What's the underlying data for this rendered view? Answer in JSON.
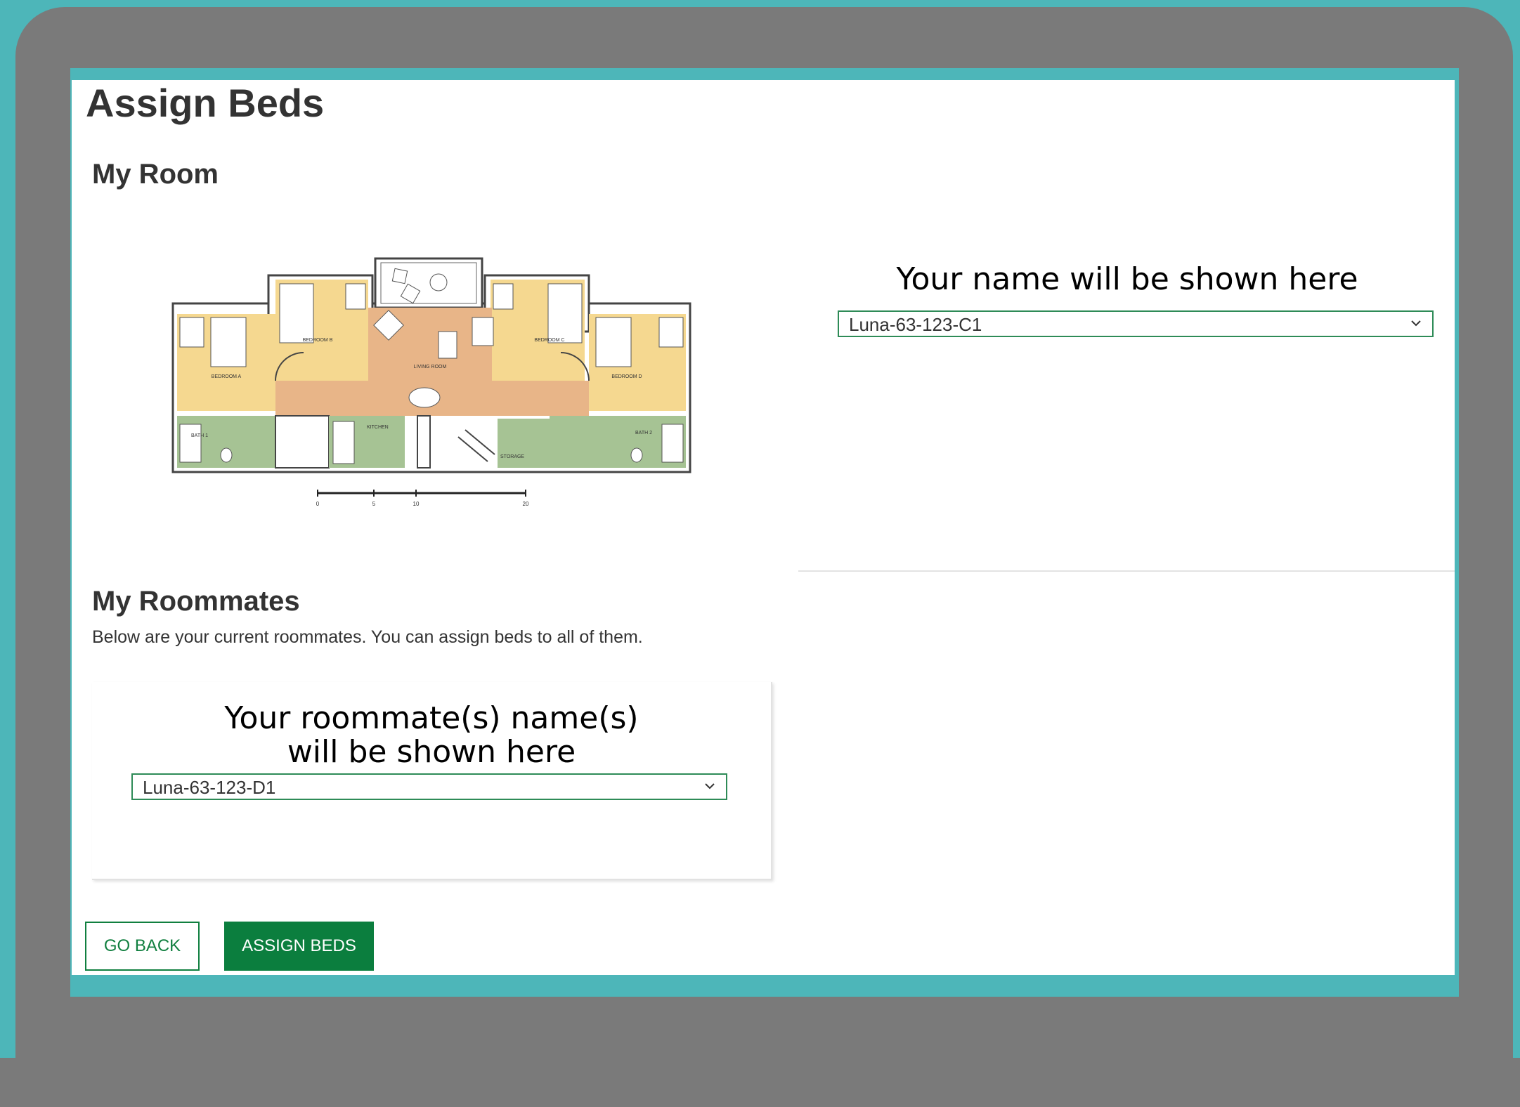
{
  "page": {
    "title": "Assign Beds"
  },
  "my_room": {
    "heading": "My Room",
    "floorplan_labels": {
      "bedroom_a": "BEDROOM A",
      "bedroom_b": "BEDROOM B",
      "bedroom_c": "BEDROOM C",
      "bedroom_d": "BEDROOM D",
      "living_room": "LIVING ROOM",
      "kitchen": "KITCHEN",
      "bath_1": "BATH 1",
      "bath_2": "BATH 2",
      "storage": "STORAGE",
      "scale_0": "0",
      "scale_5": "5",
      "scale_10": "10",
      "scale_20": "20"
    },
    "note": "Your name will be shown here",
    "bed_select": {
      "value": "Luna-63-123-C1"
    }
  },
  "roommates": {
    "heading": "My Roommates",
    "description": "Below are your current roommates. You can assign beds to all of them.",
    "note_line1": "Your roommate(s) name(s)",
    "note_line2": "will be shown here",
    "bed_select": {
      "value": "Luna-63-123-D1"
    }
  },
  "actions": {
    "go_back_label": "GO BACK",
    "assign_label": "ASSIGN BEDS"
  },
  "colors": {
    "teal_frame": "#4db6b9",
    "bezel": "#7a7a7a",
    "accent_green": "#0b7e3e",
    "bedroom_fill": "#f5d890",
    "living_fill": "#e8b588",
    "bath_fill": "#a6c394"
  },
  "icons": [
    "chevron-down-icon",
    "chevron-down-icon"
  ]
}
